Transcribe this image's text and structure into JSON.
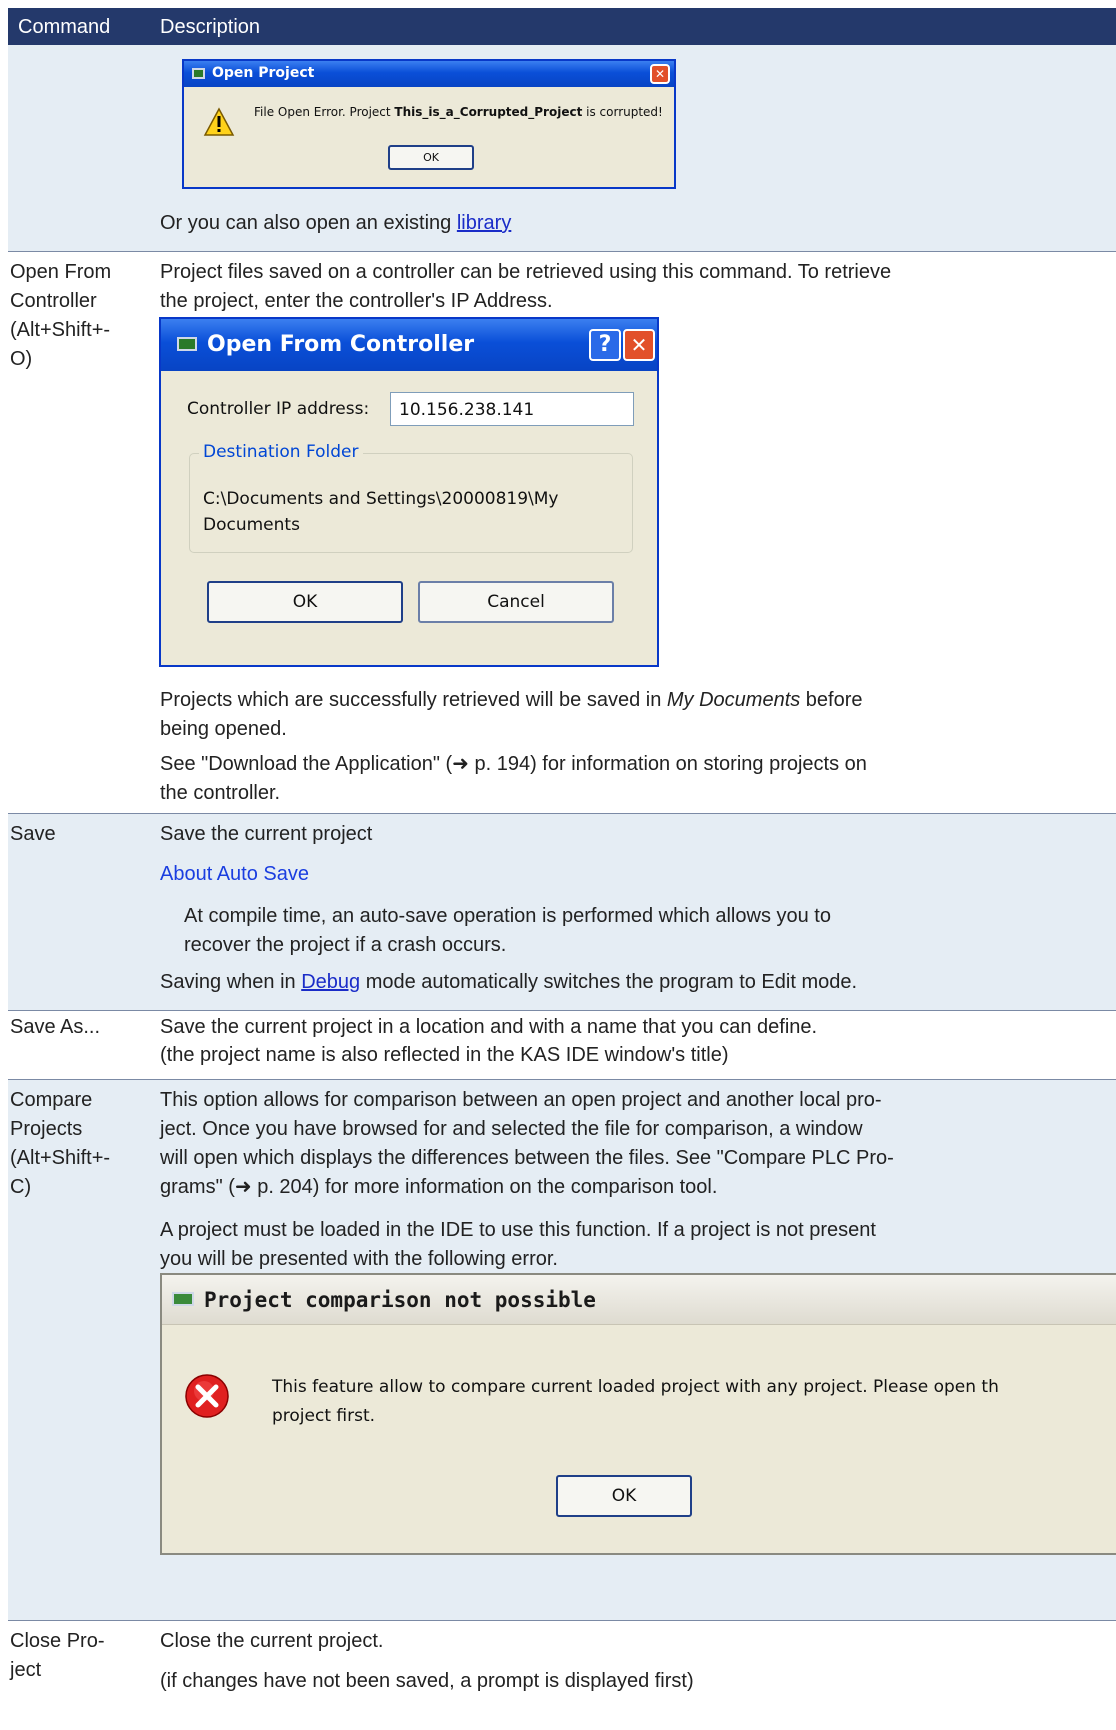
{
  "header": {
    "col1": "Command",
    "col2": "Description"
  },
  "row1": {
    "dialog": {
      "title": "Open Project",
      "close_glyph": "✕",
      "msg_pre": "File Open Error. Project ",
      "msg_bold": "This_is_a_Corrupted_Project",
      "msg_post": " is corrupted!",
      "ok": "OK"
    },
    "text_pre": "Or you can also open an existing ",
    "link": "library"
  },
  "row2": {
    "command": [
      "Open From",
      "Controller",
      "(Alt+Shift+-",
      "O)"
    ],
    "p1_line1": "Project files saved on a controller can be retrieved using this command. To retrieve",
    "p1_line2": "the project, enter the controller's IP Address.",
    "dialog": {
      "title": "Open From Controller",
      "help_glyph": "?",
      "close_glyph": "✕",
      "ip_label": "Controller IP address:",
      "ip_value": "10.156.238.141",
      "group_label": "Destination Folder",
      "path_line1": "C:\\Documents and Settings\\20000819\\My",
      "path_line2": "Documents",
      "ok": "OK",
      "cancel": "Cancel"
    },
    "p2_line1_pre": "Projects which are successfully retrieved will be saved in ",
    "p2_line1_em": "My Documents",
    "p2_line1_post": " before",
    "p2_line2": "being opened.",
    "p3_line1": "See \"Download the Application\" (➜ p. 194) for information on storing projects on",
    "p3_line2": "the controller."
  },
  "row3": {
    "command": "Save",
    "p1": "Save the current project",
    "about": "About Auto Save",
    "indent_line1": "At compile time, an auto-save operation is performed which allows you to",
    "indent_line2": "recover the project if a crash occurs.",
    "p3_pre": "Saving when in ",
    "p3_link": "Debug",
    "p3_post": " mode automatically switches the program to Edit mode."
  },
  "row4": {
    "command": "Save As...",
    "line1": "Save the current project in a location and with a name that you can define.",
    "line2": "(the project name is also reflected in the KAS IDE window's title)"
  },
  "row5": {
    "command": [
      "Compare",
      "Projects",
      "(Alt+Shift+-",
      "C)"
    ],
    "p1": [
      "This option allows for comparison between an open project and another local pro-",
      "ject. Once you have browsed for and selected the file for comparison, a window",
      "will open which displays the differences between the files. See \"Compare PLC Pro-",
      "grams\" (➜ p. 204) for more information on the comparison tool."
    ],
    "p2_line1": "A project must be loaded in the IDE to use this function. If a project is not present",
    "p2_line2": "you will be presented with the following error.",
    "dialog": {
      "title": "Project comparison not possible",
      "msg_line1": "This feature allow to compare current loaded project with any project. Please open th",
      "msg_line2": "project first.",
      "ok": "OK"
    }
  },
  "row6": {
    "command": [
      "Close Pro-",
      "ject"
    ],
    "line1": "Close the current project.",
    "line2": "(if changes have not been saved, a prompt is displayed first)"
  }
}
